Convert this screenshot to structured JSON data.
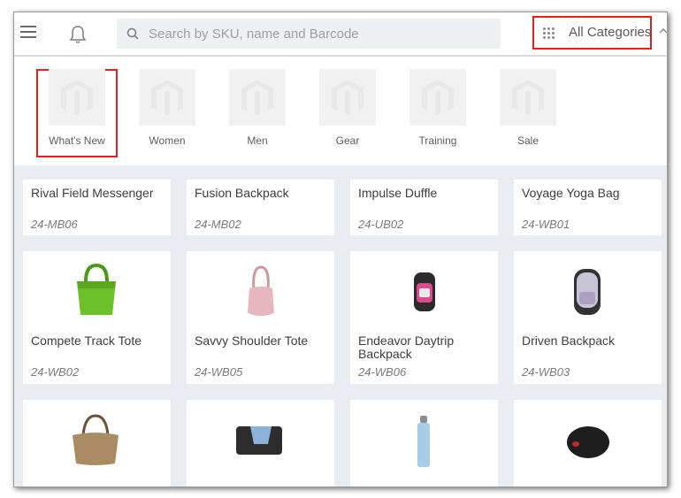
{
  "header": {
    "search_placeholder": "Search by SKU, name and Barcode",
    "categories_label": "All Categories"
  },
  "categories": [
    {
      "label": "What's New",
      "selected": true
    },
    {
      "label": "Women",
      "selected": false
    },
    {
      "label": "Men",
      "selected": false
    },
    {
      "label": "Gear",
      "selected": false
    },
    {
      "label": "Training",
      "selected": false
    },
    {
      "label": "Sale",
      "selected": false
    }
  ],
  "products_row1": [
    {
      "name": "Rival Field Messenger",
      "sku": "24-MB06"
    },
    {
      "name": "Fusion Backpack",
      "sku": "24-MB02"
    },
    {
      "name": "Impulse Duffle",
      "sku": "24-UB02"
    },
    {
      "name": "Voyage Yoga Bag",
      "sku": "24-WB01"
    }
  ],
  "products_row2": [
    {
      "name": "Compete Track Tote",
      "sku": "24-WB02"
    },
    {
      "name": "Savvy Shoulder Tote",
      "sku": "24-WB05"
    },
    {
      "name": "Endeavor Daytrip Backpack",
      "sku": "24-WB06"
    },
    {
      "name": "Driven Backpack",
      "sku": "24-WB03"
    }
  ],
  "colors": {
    "highlight": "#e0201b",
    "background": "#e9ecf0"
  }
}
